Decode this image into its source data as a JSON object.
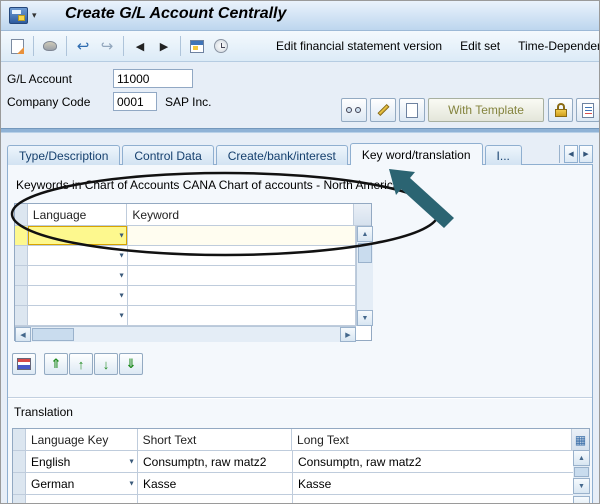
{
  "window": {
    "title": "Create G/L Account Centrally"
  },
  "toolbar": {
    "items": [
      "Edit financial statement version",
      "Edit set",
      "Time-Dependent"
    ]
  },
  "form": {
    "gl_account": {
      "label": "G/L Account",
      "value": "11000"
    },
    "company_code": {
      "label": "Company Code",
      "value": "0001",
      "company_name": "SAP Inc."
    },
    "with_template_label": "With Template"
  },
  "tabs": {
    "active_index": 3,
    "items": [
      {
        "label": "Type/Description"
      },
      {
        "label": "Control Data"
      },
      {
        "label": "Create/bank/interest"
      },
      {
        "label": "Key word/translation"
      },
      {
        "label": "I..."
      }
    ]
  },
  "keywords": {
    "title": "Keywords in Chart of Accounts CANA Chart of accounts - North America",
    "columns": {
      "language": "Language",
      "keyword": "Keyword"
    },
    "rows": [
      {
        "language": "",
        "keyword": ""
      },
      {
        "language": "",
        "keyword": ""
      },
      {
        "language": "",
        "keyword": ""
      },
      {
        "language": "",
        "keyword": ""
      },
      {
        "language": "",
        "keyword": ""
      }
    ]
  },
  "translation": {
    "title": "Translation",
    "columns": {
      "language_key": "Language Key",
      "short_text": "Short Text",
      "long_text": "Long Text"
    },
    "rows": [
      {
        "language_key": "English",
        "short_text": "Consumptn, raw matz2",
        "long_text": "Consumptn, raw matz2"
      },
      {
        "language_key": "German",
        "short_text": "Kasse",
        "long_text": "Kasse"
      }
    ]
  },
  "colors": {
    "focus_cell": "#fdf88e",
    "annotation_arrow": "#2b6472",
    "annotation_outline": "#111111"
  }
}
